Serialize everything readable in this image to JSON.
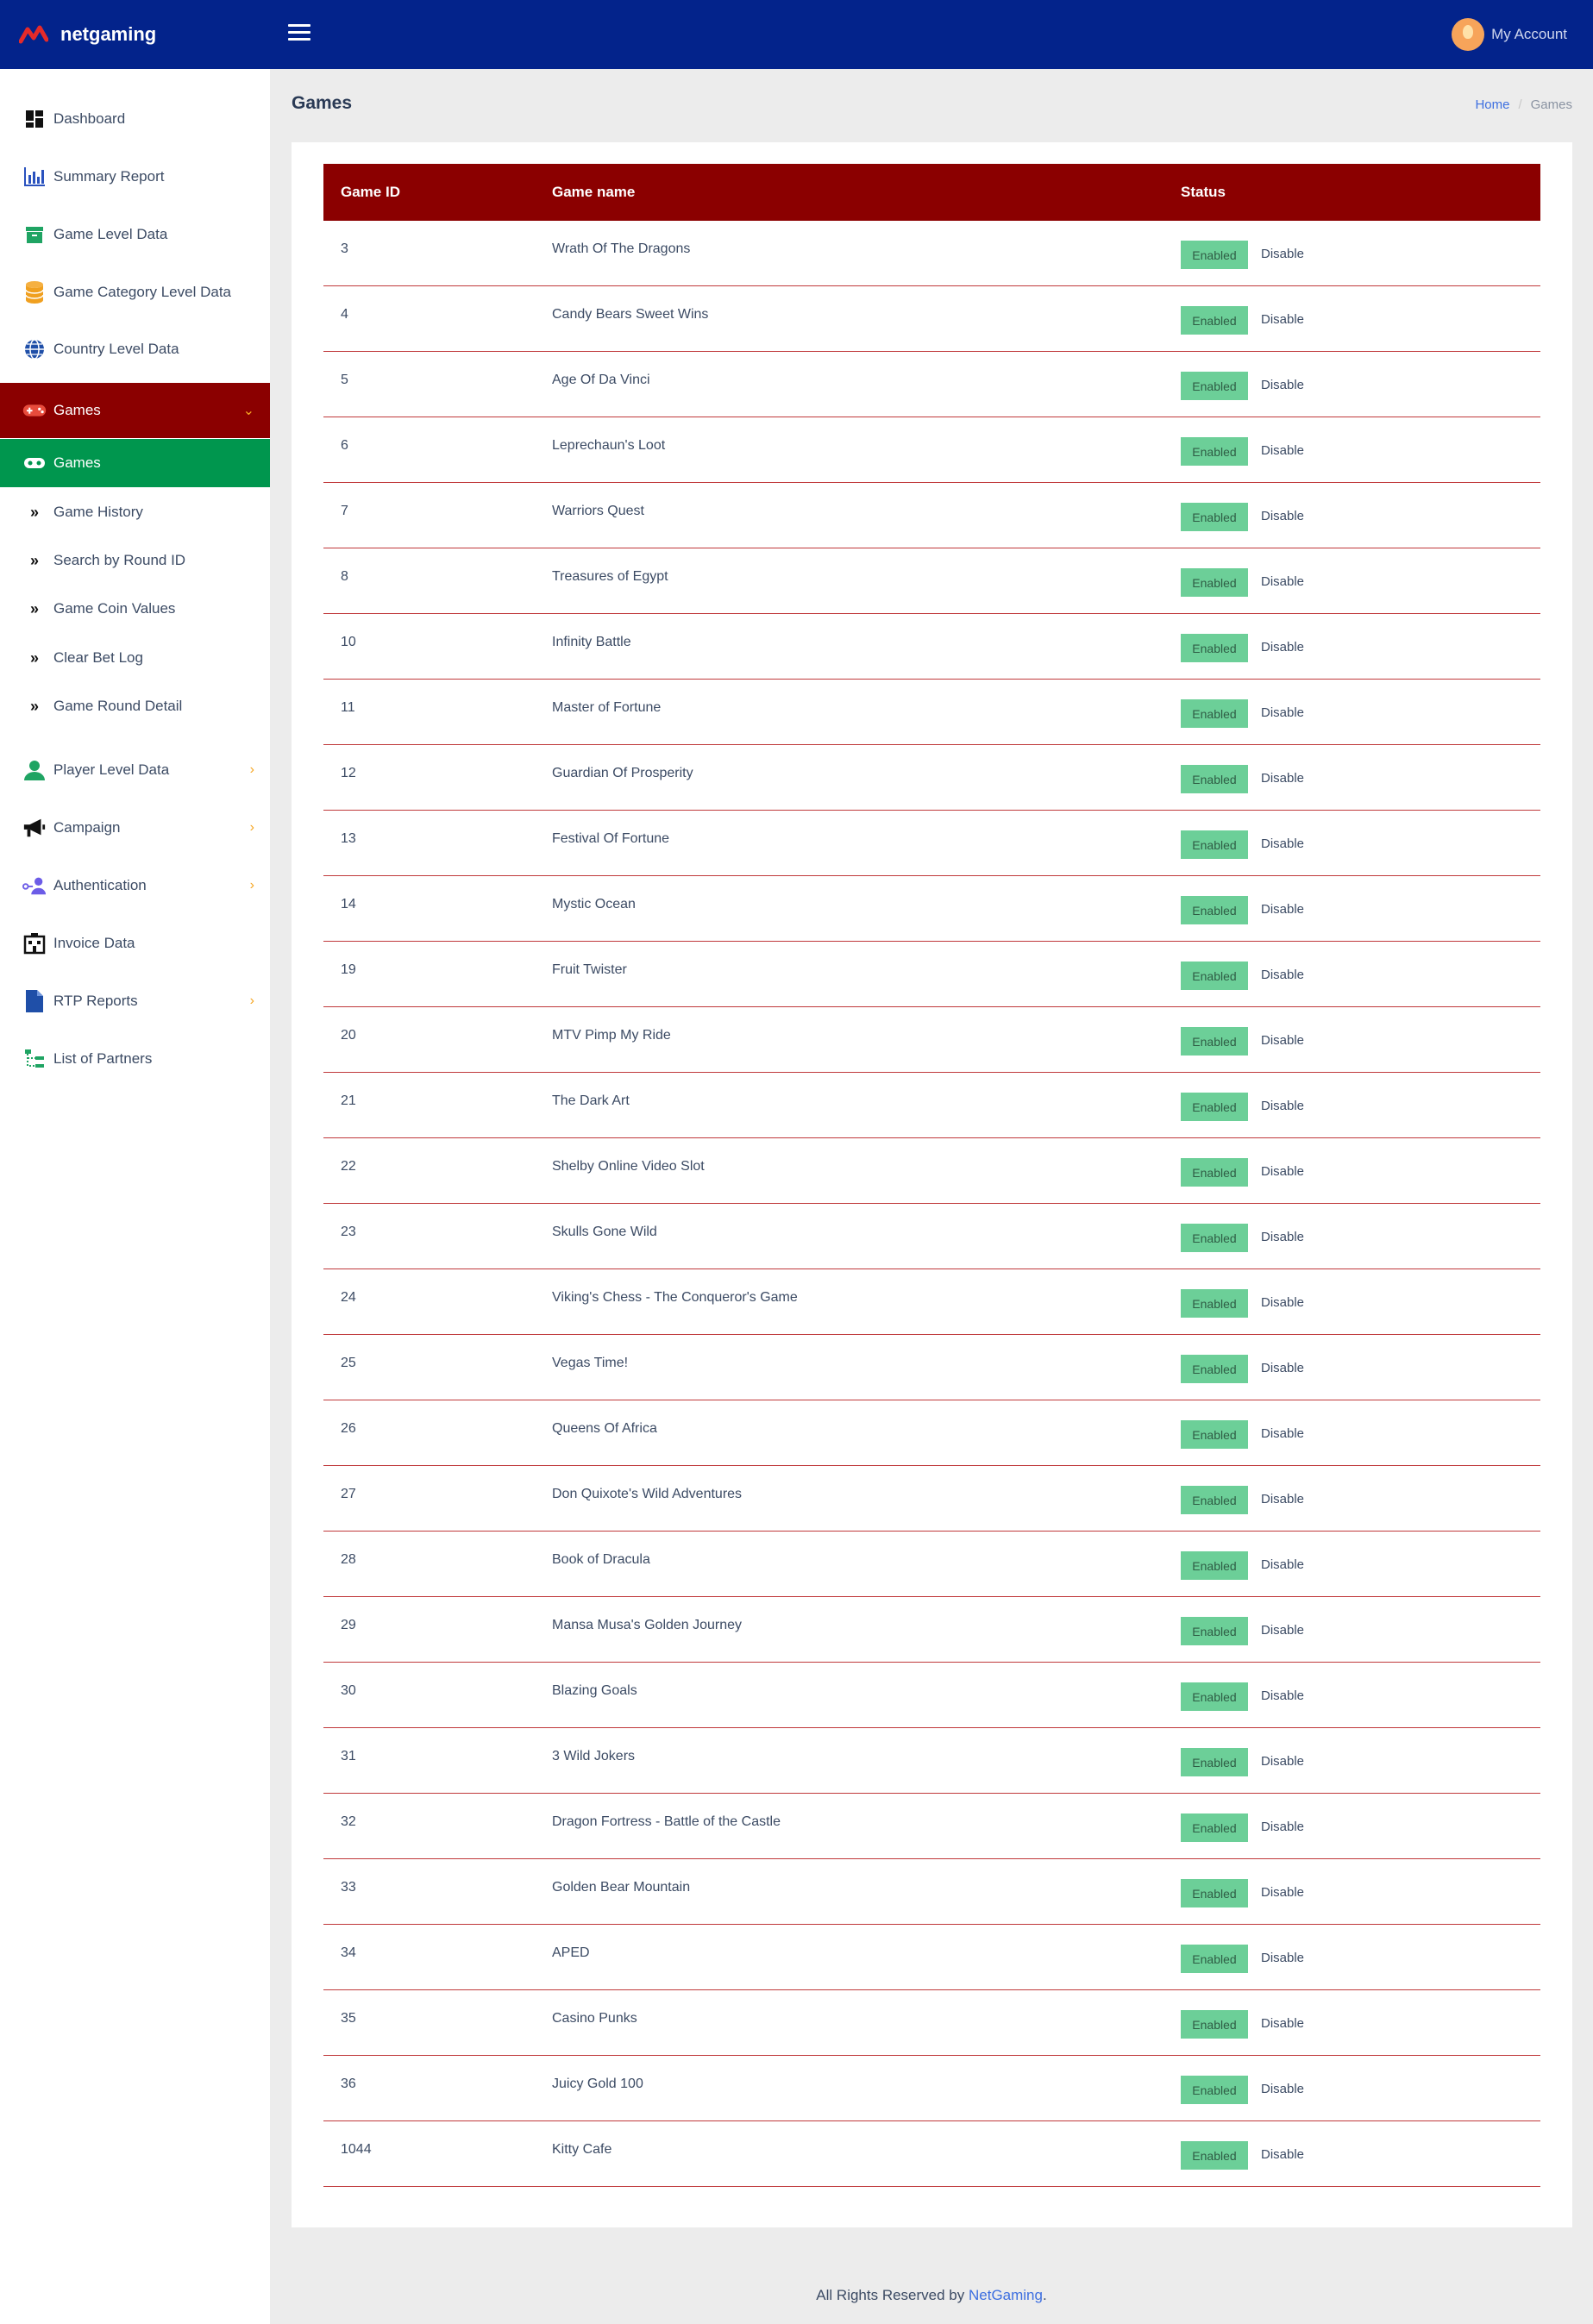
{
  "brand": {
    "name": "netgaming"
  },
  "header": {
    "account_label": "My Account"
  },
  "sidebar": {
    "items": [
      {
        "label": "Dashboard"
      },
      {
        "label": "Summary Report"
      },
      {
        "label": "Game Level Data"
      },
      {
        "label": "Game Category Level Data"
      },
      {
        "label": "Country Level Data"
      },
      {
        "label": "Games"
      },
      {
        "label": "Games"
      },
      {
        "label": "Game History"
      },
      {
        "label": "Search by Round ID"
      },
      {
        "label": "Game Coin Values"
      },
      {
        "label": "Clear Bet Log"
      },
      {
        "label": "Game Round Detail"
      },
      {
        "label": "Player Level Data"
      },
      {
        "label": "Campaign"
      },
      {
        "label": "Authentication"
      },
      {
        "label": "Invoice Data"
      },
      {
        "label": "RTP Reports"
      },
      {
        "label": "List of Partners"
      }
    ]
  },
  "page": {
    "title": "Games",
    "breadcrumb": {
      "home": "Home",
      "sep": "/",
      "current": "Games"
    }
  },
  "table": {
    "headers": [
      "Game ID",
      "Game name",
      "Status"
    ],
    "status_label": "Enabled",
    "action_label": "Disable",
    "rows": [
      {
        "id": "3",
        "name": "Wrath Of The Dragons"
      },
      {
        "id": "4",
        "name": "Candy Bears Sweet Wins"
      },
      {
        "id": "5",
        "name": "Age Of Da Vinci"
      },
      {
        "id": "6",
        "name": "Leprechaun's Loot"
      },
      {
        "id": "7",
        "name": "Warriors Quest"
      },
      {
        "id": "8",
        "name": "Treasures of Egypt"
      },
      {
        "id": "10",
        "name": "Infinity Battle"
      },
      {
        "id": "11",
        "name": "Master of Fortune"
      },
      {
        "id": "12",
        "name": "Guardian Of Prosperity"
      },
      {
        "id": "13",
        "name": "Festival Of Fortune"
      },
      {
        "id": "14",
        "name": "Mystic Ocean"
      },
      {
        "id": "19",
        "name": "Fruit Twister"
      },
      {
        "id": "20",
        "name": "MTV Pimp My Ride"
      },
      {
        "id": "21",
        "name": "The Dark Art"
      },
      {
        "id": "22",
        "name": "Shelby Online Video Slot"
      },
      {
        "id": "23",
        "name": "Skulls Gone Wild"
      },
      {
        "id": "24",
        "name": "Viking's Chess - The Conqueror's Game"
      },
      {
        "id": "25",
        "name": "Vegas Time!"
      },
      {
        "id": "26",
        "name": "Queens Of Africa"
      },
      {
        "id": "27",
        "name": "Don Quixote's Wild Adventures"
      },
      {
        "id": "28",
        "name": "Book of Dracula"
      },
      {
        "id": "29",
        "name": "Mansa Musa's Golden Journey"
      },
      {
        "id": "30",
        "name": "Blazing Goals"
      },
      {
        "id": "31",
        "name": "3 Wild Jokers"
      },
      {
        "id": "32",
        "name": "Dragon Fortress - Battle of the Castle"
      },
      {
        "id": "33",
        "name": "Golden Bear Mountain"
      },
      {
        "id": "34",
        "name": "APED"
      },
      {
        "id": "35",
        "name": "Casino Punks"
      },
      {
        "id": "36",
        "name": "Juicy Gold 100"
      },
      {
        "id": "1044",
        "name": "Kitty Cafe"
      }
    ]
  },
  "footer": {
    "text": "All Rights Reserved by ",
    "link": "NetGaming",
    "suffix": "."
  },
  "colors": {
    "topbar": "#03238b",
    "active_menu": "#8b0000",
    "active_submenu": "#00964e",
    "table_header": "#8b0000",
    "enabled_badge": "#6ccf98",
    "link": "#3d6fe0"
  }
}
